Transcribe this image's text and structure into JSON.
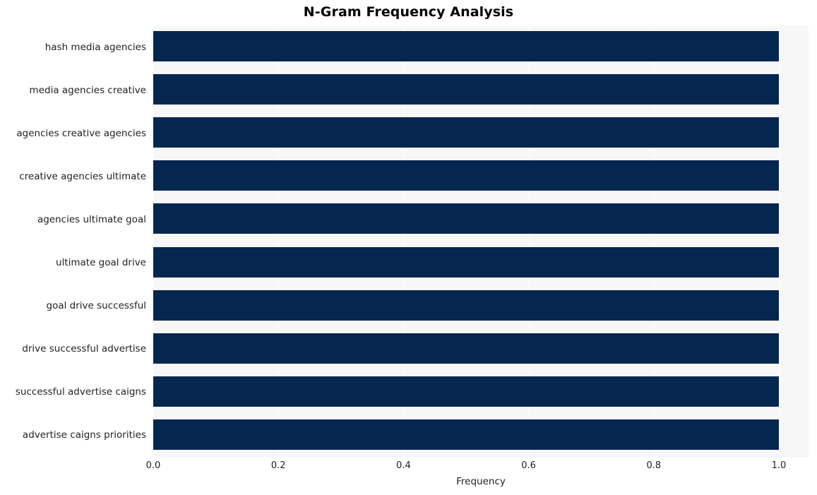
{
  "chart_data": {
    "type": "bar",
    "orientation": "horizontal",
    "title": "N-Gram Frequency Analysis",
    "xlabel": "Frequency",
    "ylabel": "",
    "xlim": [
      0.0,
      1.0
    ],
    "xticks": [
      "0.0",
      "0.2",
      "0.4",
      "0.6",
      "0.8",
      "1.0"
    ],
    "xtick_values": [
      0.0,
      0.2,
      0.4,
      0.6,
      0.8,
      1.0
    ],
    "grid": "vertical-white-on-gray",
    "legend": "none",
    "bar_color": "#04264f",
    "plot_background": "#f7f7f7",
    "categories": [
      "hash media agencies",
      "media agencies creative",
      "agencies creative agencies",
      "creative agencies ultimate",
      "agencies ultimate goal",
      "ultimate goal drive",
      "goal drive successful",
      "drive successful advertise",
      "successful advertise caigns",
      "advertise caigns priorities"
    ],
    "values": [
      1.0,
      1.0,
      1.0,
      1.0,
      1.0,
      1.0,
      1.0,
      1.0,
      1.0,
      1.0
    ]
  }
}
